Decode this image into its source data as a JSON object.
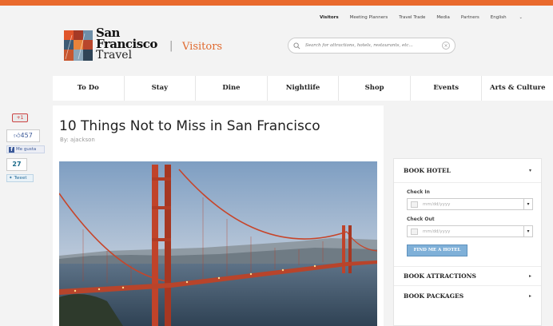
{
  "topnav": {
    "items": [
      "Visitors",
      "Meeting Planners",
      "Travel Trade",
      "Media",
      "Partners",
      "English"
    ],
    "active": "Visitors"
  },
  "header": {
    "logo_line1": "San",
    "logo_line2": "Francisco",
    "logo_line3": "Travel",
    "section": "Visitors",
    "search_placeholder": "Search for attractions, hotels, restaurants, etc..."
  },
  "mainnav": {
    "items": [
      "To Do",
      "Stay",
      "Dine",
      "Nightlife",
      "Shop",
      "Events",
      "Arts & Culture"
    ]
  },
  "social": {
    "gplus_label": "+1",
    "like_count": "457",
    "fb_label": "Me gusta",
    "tweet_count": "27",
    "tweet_label": "Tweet"
  },
  "article": {
    "title": "10 Things Not to Miss in San Francisco",
    "byline": "By: ajackson"
  },
  "sidebar": {
    "book_hotel": "BOOK HOTEL",
    "check_in_label": "Check In",
    "check_in_placeholder": "mm/dd/yyyy",
    "check_out_label": "Check Out",
    "check_out_placeholder": "mm/dd/yyyy",
    "find_button": "FIND ME A HOTEL",
    "book_attractions": "BOOK ATTRACTIONS",
    "book_packages": "BOOK PACKAGES"
  },
  "colors": {
    "accent": "#e96a2d",
    "facebook": "#3b5998",
    "button_blue": "#7fb0d8"
  }
}
